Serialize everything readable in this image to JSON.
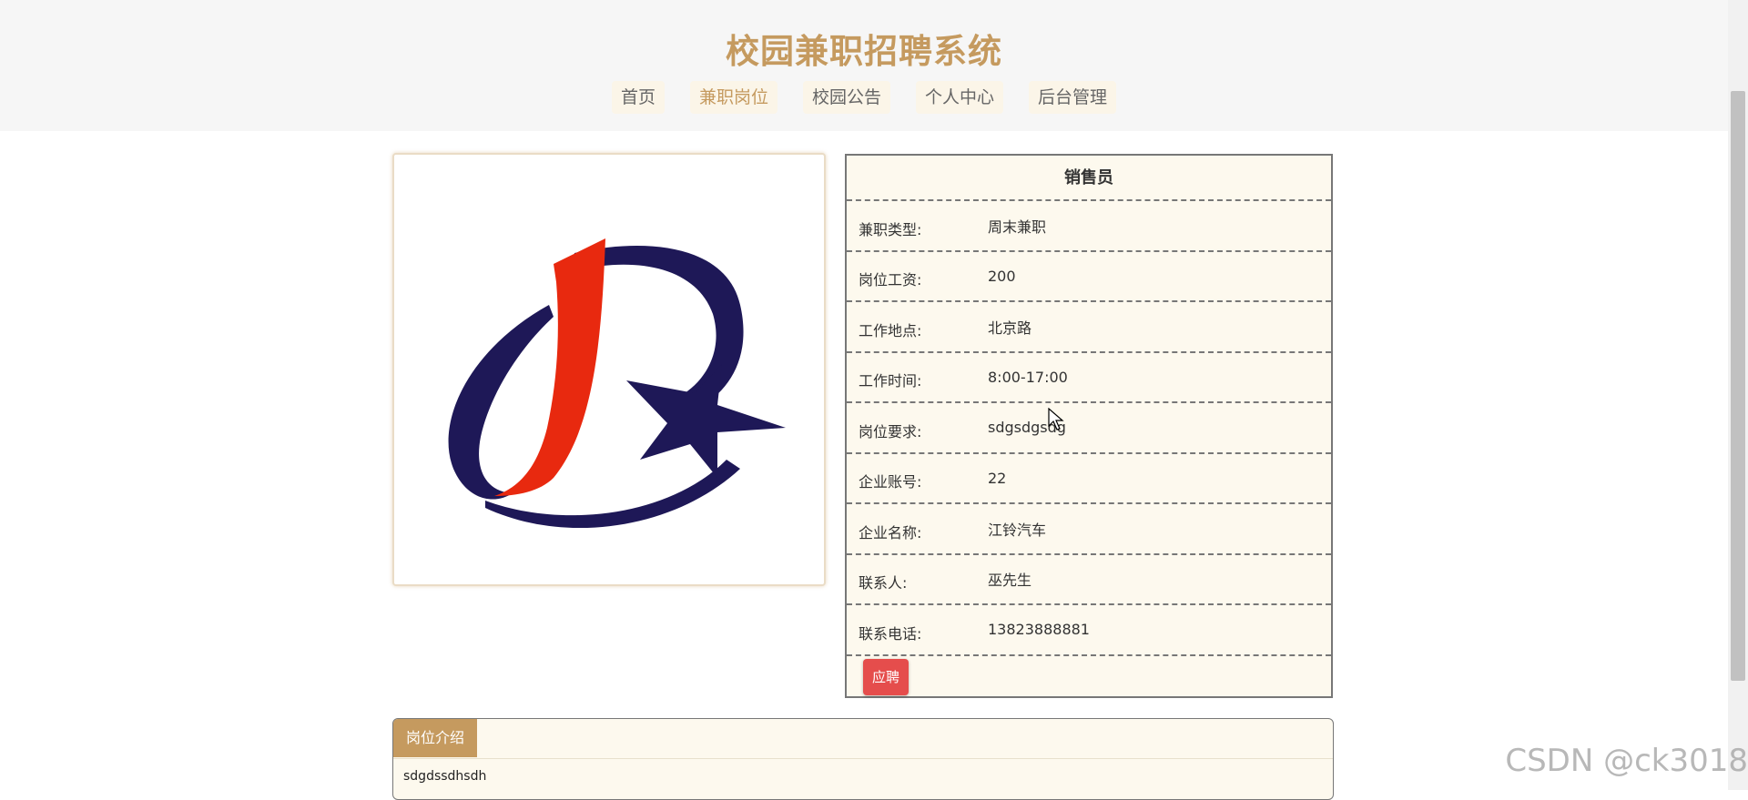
{
  "site": {
    "title": "校园兼职招聘系统"
  },
  "nav": [
    {
      "label": "首页",
      "active": false
    },
    {
      "label": "兼职岗位",
      "active": true
    },
    {
      "label": "校园公告",
      "active": false
    },
    {
      "label": "个人中心",
      "active": false
    },
    {
      "label": "后台管理",
      "active": false
    }
  ],
  "job": {
    "title": "销售员",
    "fields": [
      {
        "label": "兼职类型:",
        "value": "周末兼职"
      },
      {
        "label": "岗位工资:",
        "value": "200"
      },
      {
        "label": "工作地点:",
        "value": "北京路"
      },
      {
        "label": "工作时间:",
        "value": "8:00-17:00"
      },
      {
        "label": "岗位要求:",
        "value": "sdgsdgsdg"
      },
      {
        "label": "企业账号:",
        "value": "22"
      },
      {
        "label": "企业名称:",
        "value": "江铃汽车"
      },
      {
        "label": "联系人:",
        "value": "巫先生"
      },
      {
        "label": "联系电话:",
        "value": "13823888881"
      }
    ],
    "apply_label": "应聘"
  },
  "intro": {
    "tab_label": "岗位介绍",
    "text": "sdgdssdhsdh"
  },
  "watermark": "CSDN @ck3018",
  "colors": {
    "accent": "#c59a5f",
    "apply_button": "#e54d4c",
    "logo_navy": "#1e1857",
    "logo_red": "#e8290f"
  }
}
